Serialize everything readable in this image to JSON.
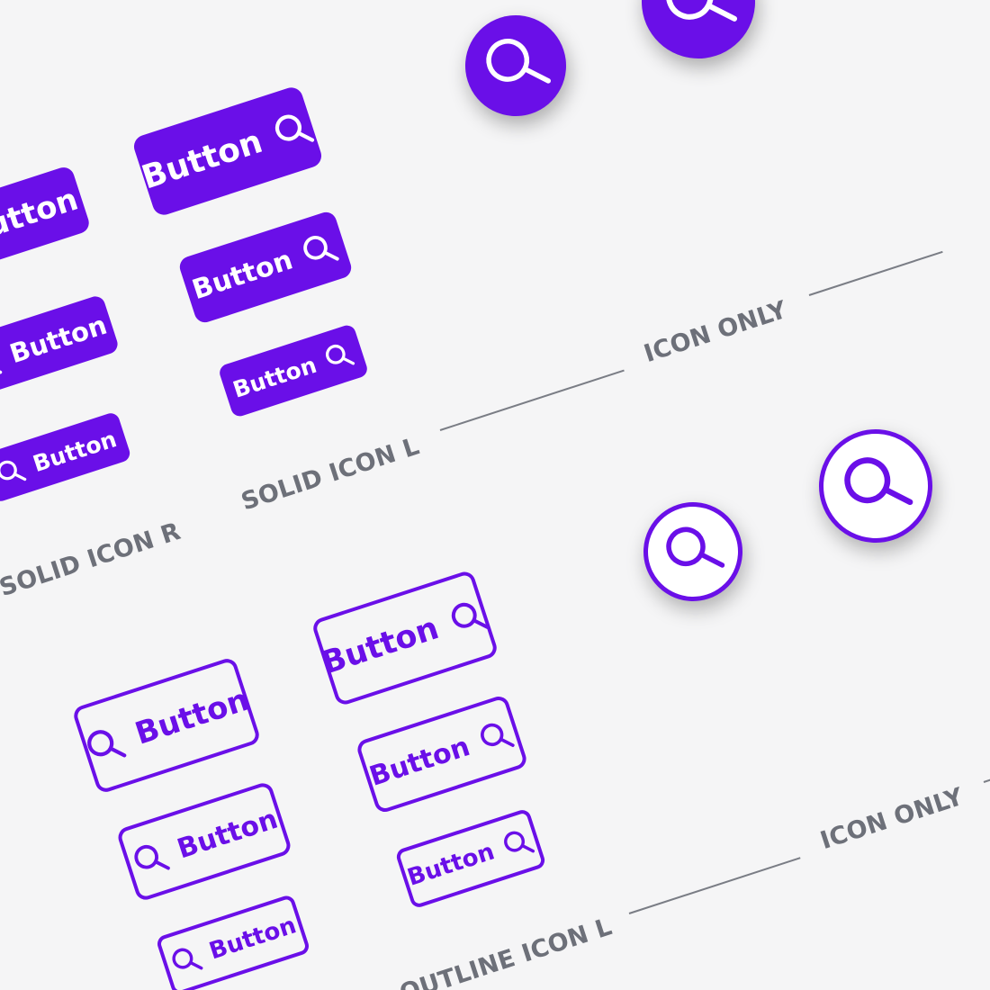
{
  "colors": {
    "brand": "#6a0fe8",
    "label": "#6d7079",
    "background": "#f5f5f6"
  },
  "icon": "search-icon",
  "sections": {
    "solid_icon_r": "SOLID ICON R",
    "solid_icon_l": "SOLID ICON L",
    "icon_only_solid": "ICON ONLY",
    "outline_icon_l": "OUTLINE ICON L",
    "icon_only_outline": "ICON ONLY"
  },
  "buttons": {
    "solid_r_large": "Button",
    "solid_r_medium": "Button",
    "solid_r_small": "Button",
    "solid_l_large": "Button",
    "solid_l_medium": "Button",
    "solid_l_small": "Button",
    "outline_r_large": "Button",
    "outline_r_medium": "Button",
    "outline_r_small": "Button",
    "outline_l_large": "Button",
    "outline_l_medium": "Button",
    "outline_l_small": "Button"
  }
}
